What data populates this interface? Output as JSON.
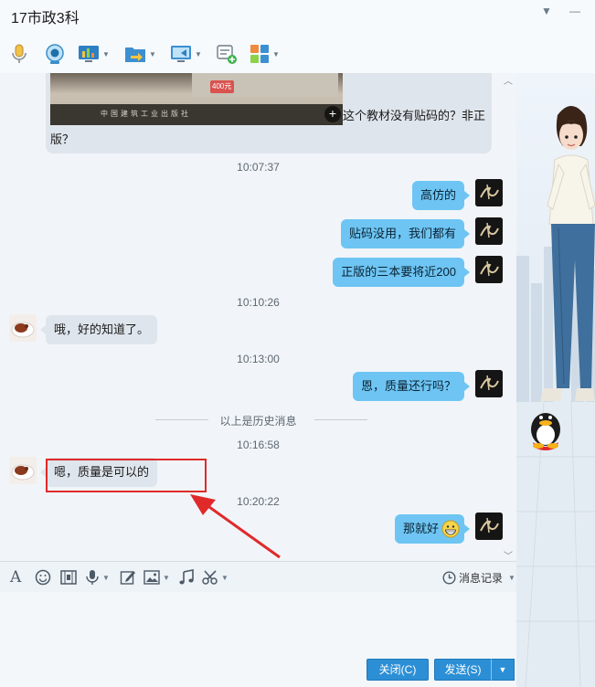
{
  "window": {
    "title": "17市政3科",
    "collapse_glyph": "▼",
    "minimize_glyph": "—"
  },
  "toolbar": {
    "items": [
      {
        "icon": "microphone-icon"
      },
      {
        "icon": "video-camera-icon"
      },
      {
        "icon": "screen-share-icon"
      },
      {
        "icon": "file-transfer-icon"
      },
      {
        "icon": "remote-desktop-icon"
      },
      {
        "icon": "create-group-icon"
      },
      {
        "icon": "apps-grid-icon"
      }
    ]
  },
  "chat": {
    "image_message": {
      "caption_line1": "这个教材没有贴码的？非正",
      "caption_line2": "版？",
      "photo_text": "中国建筑工业出版社",
      "photo_badge": "400元",
      "plus_glyph": "+"
    },
    "timestamps": [
      "10:07:37",
      "10:10:26",
      "10:13:00",
      "10:16:58",
      "10:20:22"
    ],
    "history_divider": "以上是历史消息",
    "messages": [
      {
        "side": "mine",
        "text": "高仿的"
      },
      {
        "side": "mine",
        "text": "贴码没用，我们都有"
      },
      {
        "side": "mine",
        "text": "正版的三本要将近200"
      },
      {
        "side": "theirs",
        "text": "哦，好的知道了。"
      },
      {
        "side": "mine",
        "text": "恩，质量还行吗？"
      },
      {
        "side": "theirs",
        "text": "嗯，质量是可以的"
      },
      {
        "side": "mine",
        "text": "那就好",
        "emoji": "grin-emoji-icon"
      }
    ],
    "scroll_up_glyph": "︿",
    "scroll_down_glyph": "﹀"
  },
  "annotation": {
    "box_color": "#e02a2a",
    "arrow_color": "#e02a2a"
  },
  "input_toolbar": {
    "items": [
      {
        "icon": "font-icon",
        "glyph": "A"
      },
      {
        "icon": "emoji-icon"
      },
      {
        "icon": "gif-icon"
      },
      {
        "icon": "voice-message-icon"
      },
      {
        "icon": "doodle-icon"
      },
      {
        "icon": "image-icon"
      },
      {
        "icon": "music-icon"
      },
      {
        "icon": "screenshot-scissors-icon"
      }
    ],
    "history_label": "消息记录"
  },
  "buttons": {
    "close_label": "关闭(C)",
    "send_label": "发送(S)",
    "send_caret": "▼"
  },
  "colors": {
    "my_bubble": "#6ec5f3",
    "their_bubble": "#dfe5ec",
    "button_blue": "#2c8fd6"
  }
}
